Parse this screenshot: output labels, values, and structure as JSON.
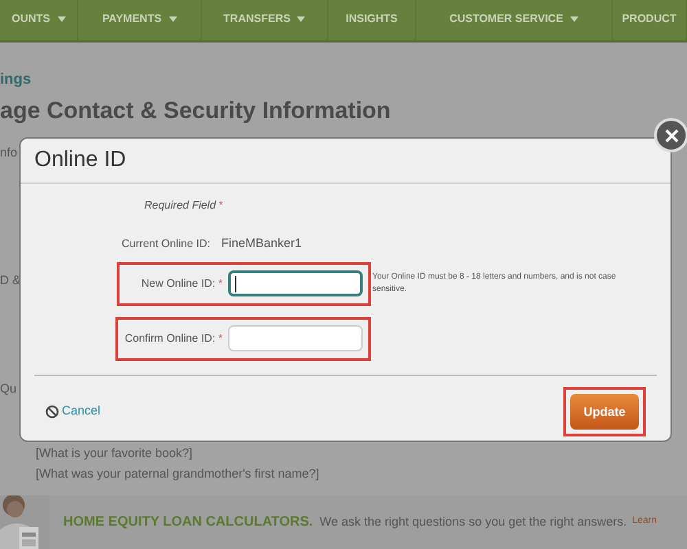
{
  "nav": {
    "items": [
      {
        "label": "OUNTS",
        "dropdown": true
      },
      {
        "label": "PAYMENTS",
        "dropdown": true
      },
      {
        "label": "TRANSFERS",
        "dropdown": true
      },
      {
        "label": "INSIGHTS",
        "dropdown": false
      },
      {
        "label": "CUSTOMER SERVICE",
        "dropdown": true
      },
      {
        "label": "PRODUCT",
        "dropdown": false
      }
    ]
  },
  "page": {
    "breadcrumb": "ings",
    "heading": "age Contact & Security Information",
    "fragments": [
      "nfo",
      "D &",
      "Qu"
    ],
    "questions": [
      "[What is your favorite book?]",
      "[What was your paternal grandmother's first name?]"
    ],
    "banner": {
      "title": "HOME EQUITY LOAN CALCULATORS.",
      "text": "We ask the right questions so you get the right answers.",
      "link": "Learn"
    }
  },
  "dialog": {
    "title": "Online ID",
    "required_note": "Required Field",
    "required_mark": "*",
    "current": {
      "label": "Current Online ID:",
      "value": "FineMBanker1"
    },
    "fields": [
      {
        "label": "New Online ID:",
        "required": true,
        "focused": true,
        "highlighted": true,
        "hint": "Your Online ID must be 8 - 18 letters and numbers, and is not case sensitive."
      },
      {
        "label": "Confirm Online ID:",
        "required": true,
        "focused": false,
        "highlighted": true
      }
    ],
    "cancel": "Cancel",
    "submit": {
      "label": "Update",
      "highlighted": true
    }
  }
}
